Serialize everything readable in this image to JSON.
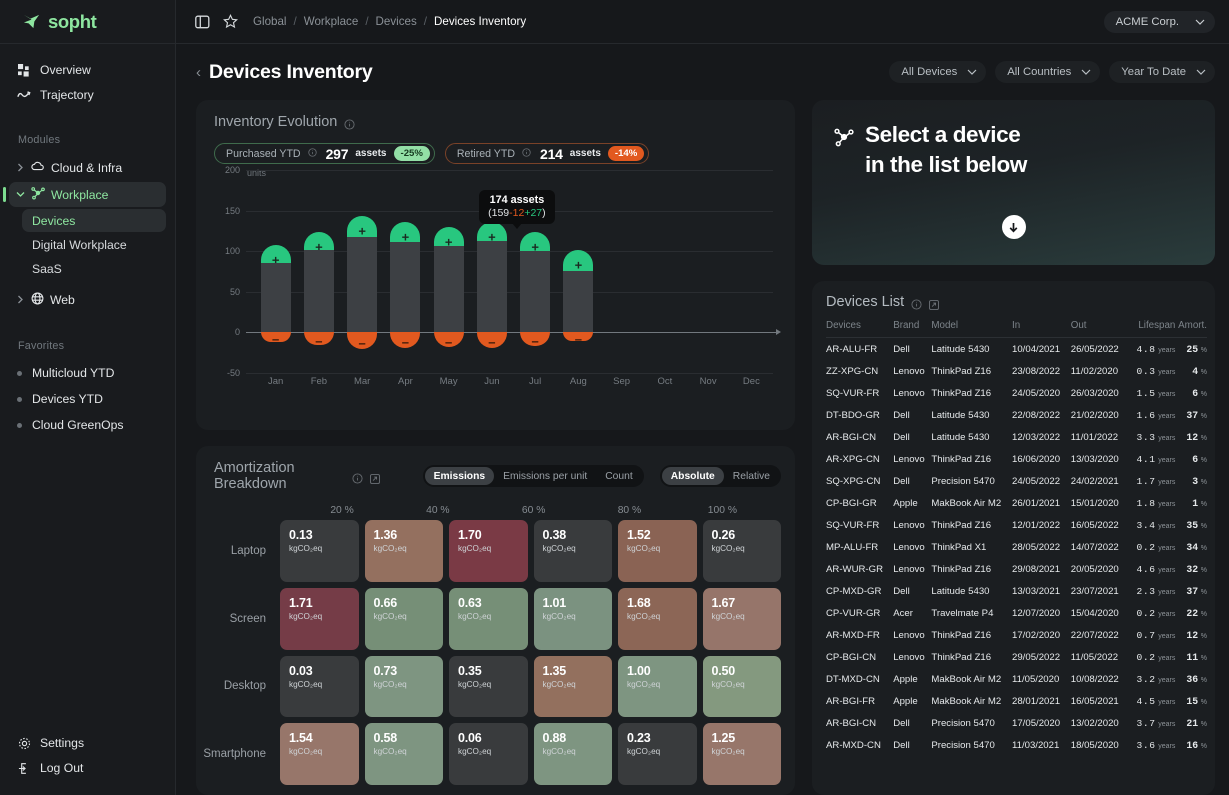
{
  "brand": {
    "name": "sopht",
    "logo_icon": "sopht-leaf-logo",
    "color": "#8ee6a0"
  },
  "sidebar": {
    "nav": [
      {
        "label": "Overview",
        "icon": "grid-squares-icon"
      },
      {
        "label": "Trajectory",
        "icon": "wave-line-icon"
      }
    ],
    "modules_label": "Modules",
    "modules": [
      {
        "label": "Cloud & Infra",
        "icon": "cloud-icon",
        "expanded": false,
        "active": false
      },
      {
        "label": "Workplace",
        "icon": "network-nodes-icon",
        "expanded": true,
        "active": true
      },
      {
        "label": "Web",
        "icon": "globe-icon",
        "expanded": false,
        "active": false
      }
    ],
    "workplace_children": [
      {
        "label": "Devices",
        "active": true
      },
      {
        "label": "Digital Workplace",
        "active": false
      },
      {
        "label": "SaaS",
        "active": false
      }
    ],
    "favorites_label": "Favorites",
    "favorites": [
      {
        "label": "Multicloud YTD"
      },
      {
        "label": "Devices YTD"
      },
      {
        "label": "Cloud GreenOps"
      }
    ],
    "bottom": [
      {
        "label": "Settings",
        "icon": "gear-icon"
      },
      {
        "label": "Log Out",
        "icon": "logout-icon"
      }
    ]
  },
  "topbar": {
    "panel_icon": "sidebar-toggle-icon",
    "star_icon": "star-icon",
    "breadcrumb": [
      "Global",
      "Workplace",
      "Devices",
      "Devices Inventory"
    ],
    "org": "ACME Corp."
  },
  "page": {
    "title": "Devices Inventory",
    "filters": [
      {
        "label": "All Devices"
      },
      {
        "label": "All Countries"
      },
      {
        "label": "Year To Date"
      }
    ]
  },
  "inventory": {
    "title": "Inventory Evolution",
    "purchased": {
      "label": "Purchased YTD",
      "value": "297",
      "unit": "assets",
      "delta": "-25%"
    },
    "retired": {
      "label": "Retired YTD",
      "value": "214",
      "unit": "assets",
      "delta": "-14%"
    },
    "tooltip": {
      "total": "174 assets",
      "open": "(159",
      "neg": "-12",
      "pos": "+27",
      "close": ")"
    }
  },
  "chart_data": {
    "type": "bar",
    "title": "Inventory Evolution",
    "ylabel": "units",
    "xlabel": "",
    "ylim": [
      -50,
      200
    ],
    "yticks": [
      200,
      150,
      100,
      50,
      0,
      -50
    ],
    "categories": [
      "Jan",
      "Feb",
      "Mar",
      "Apr",
      "May",
      "Jun",
      "Jul",
      "Aug",
      "Sep",
      "Oct",
      "Nov",
      "Dec"
    ],
    "series": [
      {
        "name": "base",
        "values": [
          85,
          101,
          117,
          111,
          107,
          112,
          100,
          76,
          null,
          null,
          null,
          null
        ]
      },
      {
        "name": "purchased",
        "values": [
          108,
          124,
          143,
          136,
          130,
          136,
          124,
          101,
          null,
          null,
          null,
          null
        ]
      },
      {
        "name": "retired",
        "values": [
          -12,
          -16,
          -20,
          -19,
          -18,
          -19,
          -17,
          -11,
          null,
          null,
          null,
          null
        ]
      }
    ],
    "grid": true,
    "legend": false
  },
  "amortization": {
    "title": "Amortization Breakdown",
    "metric_toggle": {
      "options": [
        "Emissions",
        "Emissions per unit",
        "Count"
      ],
      "selected": "Emissions"
    },
    "scale_toggle": {
      "options": [
        "Absolute",
        "Relative"
      ],
      "selected": "Absolute"
    },
    "pct_ticks": [
      "20 %",
      "40 %",
      "60 %",
      "80 %",
      "100 %"
    ],
    "unit": "kgCO₂eq",
    "rows": [
      {
        "label": "Laptop",
        "cells": [
          {
            "value": "0.13",
            "color": "#393b3d"
          },
          {
            "value": "1.36",
            "color": "#94705f"
          },
          {
            "value": "1.70",
            "color": "#7a3a45"
          },
          {
            "value": "0.38",
            "color": "#393b3d"
          },
          {
            "value": "1.52",
            "color": "#8a6354"
          },
          {
            "value": "0.26",
            "color": "#393b3d"
          }
        ]
      },
      {
        "label": "Screen",
        "cells": [
          {
            "value": "1.71",
            "color": "#753c47"
          },
          {
            "value": "0.66",
            "color": "#768f77"
          },
          {
            "value": "0.63",
            "color": "#768f77"
          },
          {
            "value": "1.01",
            "color": "#7b9280"
          },
          {
            "value": "1.68",
            "color": "#8c6656"
          },
          {
            "value": "1.67",
            "color": "#96756a"
          }
        ]
      },
      {
        "label": "Desktop",
        "cells": [
          {
            "value": "0.03",
            "color": "#393b3d"
          },
          {
            "value": "0.73",
            "color": "#7e9581"
          },
          {
            "value": "0.35",
            "color": "#393b3d"
          },
          {
            "value": "1.35",
            "color": "#93705e"
          },
          {
            "value": "1.00",
            "color": "#7e9581"
          },
          {
            "value": "0.50",
            "color": "#84997f"
          }
        ]
      },
      {
        "label": "Smartphone",
        "cells": [
          {
            "value": "1.54",
            "color": "#97766a"
          },
          {
            "value": "0.58",
            "color": "#7e9581"
          },
          {
            "value": "0.06",
            "color": "#393b3d"
          },
          {
            "value": "0.88",
            "color": "#7e9581"
          },
          {
            "value": "0.23",
            "color": "#393b3d"
          },
          {
            "value": "1.25",
            "color": "#97766a"
          }
        ]
      }
    ]
  },
  "select_device": {
    "icon": "network-nodes-icon",
    "line1": "Select a device",
    "line2": "in the list below",
    "arrow_icon": "arrow-down-circle-icon"
  },
  "devices_list": {
    "title": "Devices List",
    "columns": [
      "Devices",
      "Brand",
      "Model",
      "In",
      "Out",
      "Lifespan",
      "Amort."
    ],
    "lifespan_unit": "years",
    "amort_unit": "%",
    "rows": [
      {
        "device": "AR-ALU-FR",
        "brand": "Dell",
        "model": "Latitude 5430",
        "in": "10/04/2021",
        "out": "26/05/2022",
        "lifespan": "4.8",
        "amort": "25"
      },
      {
        "device": "ZZ-XPG-CN",
        "brand": "Lenovo",
        "model": "ThinkPad Z16",
        "in": "23/08/2022",
        "out": "11/02/2020",
        "lifespan": "0.3",
        "amort": "4"
      },
      {
        "device": "SQ-VUR-FR",
        "brand": "Lenovo",
        "model": "ThinkPad Z16",
        "in": "24/05/2020",
        "out": "26/03/2020",
        "lifespan": "1.5",
        "amort": "6"
      },
      {
        "device": "DT-BDO-GR",
        "brand": "Dell",
        "model": "Latitude 5430",
        "in": "22/08/2022",
        "out": "21/02/2020",
        "lifespan": "1.6",
        "amort": "37"
      },
      {
        "device": "AR-BGI-CN",
        "brand": "Dell",
        "model": "Latitude 5430",
        "in": "12/03/2022",
        "out": "11/01/2022",
        "lifespan": "3.3",
        "amort": "12"
      },
      {
        "device": "AR-XPG-CN",
        "brand": "Lenovo",
        "model": "ThinkPad Z16",
        "in": "16/06/2020",
        "out": "13/03/2020",
        "lifespan": "4.1",
        "amort": "6"
      },
      {
        "device": "SQ-XPG-CN",
        "brand": "Dell",
        "model": "Precision 5470",
        "in": "24/05/2022",
        "out": "24/02/2021",
        "lifespan": "1.7",
        "amort": "3"
      },
      {
        "device": "CP-BGI-GR",
        "brand": "Apple",
        "model": "MakBook Air M2",
        "in": "26/01/2021",
        "out": "15/01/2020",
        "lifespan": "1.8",
        "amort": "1"
      },
      {
        "device": "SQ-VUR-FR",
        "brand": "Lenovo",
        "model": "ThinkPad Z16",
        "in": "12/01/2022",
        "out": "16/05/2022",
        "lifespan": "3.4",
        "amort": "35"
      },
      {
        "device": "MP-ALU-FR",
        "brand": "Lenovo",
        "model": "ThinkPad X1",
        "in": "28/05/2022",
        "out": "14/07/2022",
        "lifespan": "0.2",
        "amort": "34"
      },
      {
        "device": "AR-WUR-GR",
        "brand": "Lenovo",
        "model": "ThinkPad Z16",
        "in": "29/08/2021",
        "out": "20/05/2020",
        "lifespan": "4.6",
        "amort": "32"
      },
      {
        "device": "CP-MXD-GR",
        "brand": "Dell",
        "model": "Latitude 5430",
        "in": "13/03/2021",
        "out": "23/07/2021",
        "lifespan": "2.3",
        "amort": "37"
      },
      {
        "device": "CP-VUR-GR",
        "brand": "Acer",
        "model": "Travelmate P4",
        "in": "12/07/2020",
        "out": "15/04/2020",
        "lifespan": "0.2",
        "amort": "22"
      },
      {
        "device": "AR-MXD-FR",
        "brand": "Lenovo",
        "model": "ThinkPad Z16",
        "in": "17/02/2020",
        "out": "22/07/2022",
        "lifespan": "0.7",
        "amort": "12"
      },
      {
        "device": "CP-BGI-CN",
        "brand": "Lenovo",
        "model": "ThinkPad Z16",
        "in": "29/05/2022",
        "out": "11/05/2022",
        "lifespan": "0.2",
        "amort": "11"
      },
      {
        "device": "DT-MXD-CN",
        "brand": "Apple",
        "model": "MakBook Air M2",
        "in": "11/05/2020",
        "out": "10/08/2022",
        "lifespan": "3.2",
        "amort": "36"
      },
      {
        "device": "AR-BGI-FR",
        "brand": "Apple",
        "model": "MakBook Air M2",
        "in": "28/01/2021",
        "out": "16/05/2021",
        "lifespan": "4.5",
        "amort": "15"
      },
      {
        "device": "AR-BGI-CN",
        "brand": "Dell",
        "model": "Precision 5470",
        "in": "17/05/2020",
        "out": "13/02/2020",
        "lifespan": "3.7",
        "amort": "21"
      },
      {
        "device": "AR-MXD-CN",
        "brand": "Dell",
        "model": "Precision 5470",
        "in": "11/03/2021",
        "out": "18/05/2020",
        "lifespan": "3.6",
        "amort": "16"
      }
    ]
  }
}
